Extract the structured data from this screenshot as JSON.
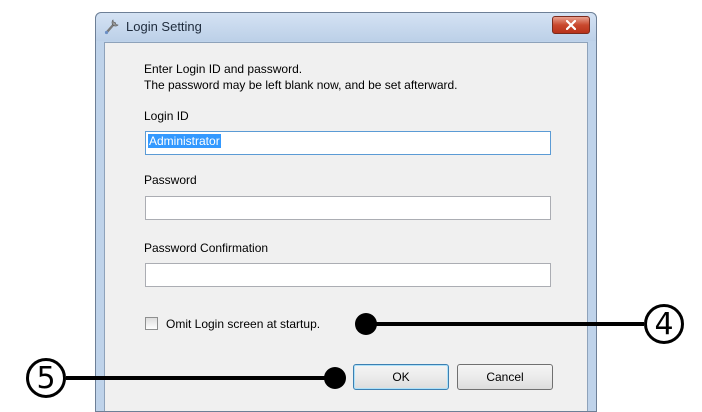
{
  "window": {
    "title": "Login Setting",
    "title_icon": "wrench-icon",
    "close_icon": "close-icon"
  },
  "instructions": {
    "line1": "Enter Login ID and password.",
    "line2": "The password may be left blank now, and be set afterward."
  },
  "login_id": {
    "label": "Login ID",
    "value": "Administrator"
  },
  "password": {
    "label": "Password",
    "value": ""
  },
  "password_confirmation": {
    "label": "Password Confirmation",
    "value": ""
  },
  "omit_login": {
    "label": "Omit Login screen at startup.",
    "checked": false
  },
  "buttons": {
    "ok": "OK",
    "cancel": "Cancel"
  },
  "callouts": {
    "four": "4",
    "five": "5"
  },
  "colors": {
    "selection": "#3399ff",
    "close_button": "#c9482e",
    "titlebar": "#bfd3ea"
  }
}
